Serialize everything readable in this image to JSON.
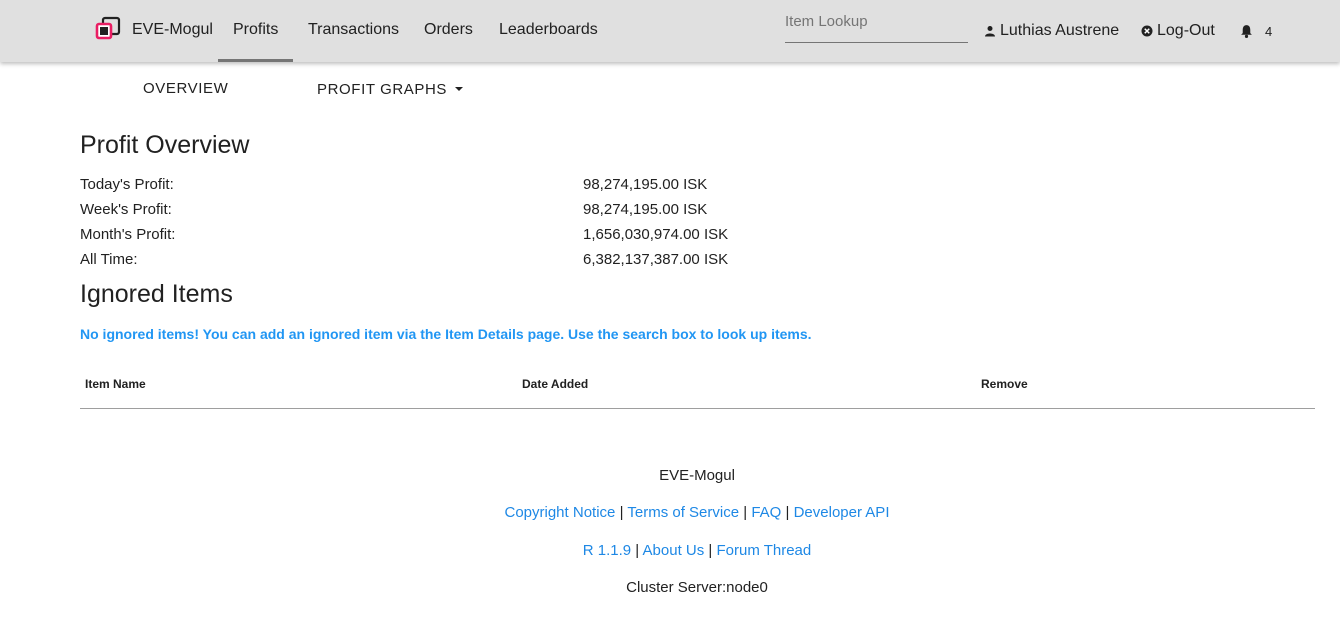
{
  "navbar": {
    "brand": "EVE-Mogul",
    "links": [
      "Profits",
      "Transactions",
      "Orders",
      "Leaderboards"
    ],
    "search_placeholder": "Item Lookup",
    "user": "Luthias Austrene",
    "logout": "Log-Out",
    "notifications": "4",
    "colors": {
      "bar": "#e0e0e0",
      "logo_pink": "#e91e63"
    }
  },
  "tabs": {
    "overview": "OVERVIEW",
    "profit_graphs": "PROFIT GRAPHS"
  },
  "profit_overview": {
    "title": "Profit Overview",
    "rows": [
      {
        "label": "Today's Profit:",
        "value": "98,274,195.00 ISK"
      },
      {
        "label": "Week's Profit:",
        "value": "98,274,195.00 ISK"
      },
      {
        "label": "Month's Profit:",
        "value": "1,656,030,974.00 ISK"
      },
      {
        "label": "All Time:",
        "value": "6,382,137,387.00 ISK"
      }
    ]
  },
  "ignored_items": {
    "title": "Ignored Items",
    "notice": "No ignored items! You can add an ignored item via the Item Details page. Use the search box to look up items.",
    "columns": [
      "Item Name",
      "Date Added",
      "Remove"
    ]
  },
  "footer": {
    "name": "EVE-Mogul",
    "links_row1": [
      "Copyright Notice",
      "Terms of Service",
      "FAQ",
      "Developer API"
    ],
    "version": "R 1.1.9",
    "links_row2": [
      "About Us",
      "Forum Thread"
    ],
    "cluster": "Cluster Server:node0",
    "separator": "|",
    "link_color": "#1e88e5"
  }
}
